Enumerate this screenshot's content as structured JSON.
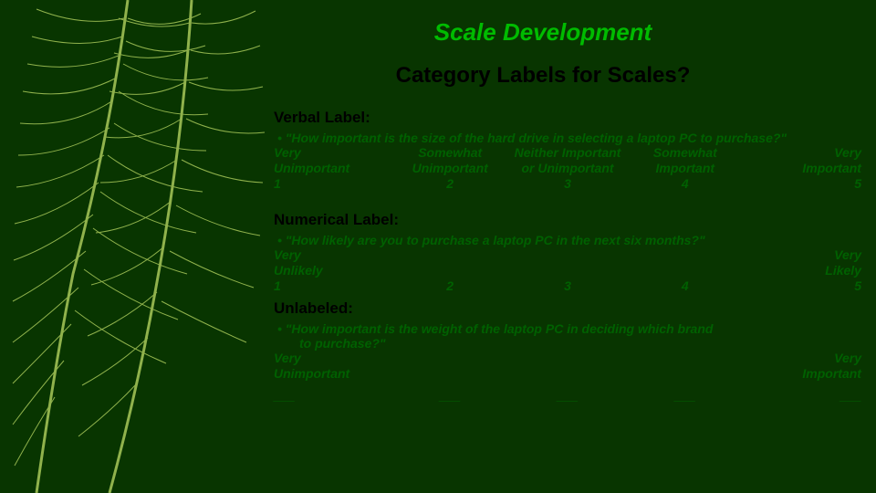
{
  "header": {
    "title": "Scale Development",
    "subtitle": "Category Labels for Scales?"
  },
  "sections": {
    "verbal": {
      "label": "Verbal Label:",
      "question": "\"How important is the size of the hard drive in selecting a laptop PC to purchase?\"",
      "cols": [
        {
          "l1": "Very",
          "l2": "Unimportant",
          "num": "1"
        },
        {
          "l1": "Somewhat",
          "l2": "Unimportant",
          "num": "2"
        },
        {
          "l1": "Neither Important",
          "l2": "or Unimportant",
          "num": "3"
        },
        {
          "l1": "Somewhat",
          "l2": "Important",
          "num": "4"
        },
        {
          "l1": "Very",
          "l2": "Important",
          "num": "5"
        }
      ]
    },
    "numerical": {
      "label": "Numerical Label:",
      "question": "\"How likely are you to purchase a laptop PC in the next six months?\"",
      "left": {
        "l1": "Very",
        "l2": "Unlikely",
        "num": "1"
      },
      "mid": [
        "2",
        "3",
        "4"
      ],
      "right": {
        "l1": "Very",
        "l2": "Likely",
        "num": "5"
      }
    },
    "unlabeled": {
      "label": "Unlabeled:",
      "question_l1": "\"How important is the weight of the laptop PC in deciding which brand",
      "question_l2": "to purchase?\"",
      "left": {
        "l1": "Very",
        "l2": "Unimportant"
      },
      "right": {
        "l1": "Very",
        "l2": "Important"
      },
      "blanks": [
        "___",
        "___",
        "___",
        "___",
        "___"
      ]
    }
  },
  "chart_data": {
    "type": "table",
    "title": "Category Labels for Scales?",
    "scales": [
      {
        "name": "Verbal Label",
        "question": "How important is the size of the hard drive in selecting a laptop PC to purchase?",
        "categories": [
          "Very Unimportant",
          "Somewhat Unimportant",
          "Neither Important or Unimportant",
          "Somewhat Important",
          "Very Important"
        ],
        "values": [
          1,
          2,
          3,
          4,
          5
        ]
      },
      {
        "name": "Numerical Label",
        "question": "How likely are you to purchase a laptop PC in the next six months?",
        "categories": [
          "Very Unlikely",
          "",
          "",
          "",
          "Very Likely"
        ],
        "values": [
          1,
          2,
          3,
          4,
          5
        ]
      },
      {
        "name": "Unlabeled",
        "question": "How important is the weight of the laptop PC in deciding which brand to purchase?",
        "categories": [
          "Very Unimportant",
          "",
          "",
          "",
          "Very Important"
        ],
        "values": [
          "___",
          "___",
          "___",
          "___",
          "___"
        ]
      }
    ]
  }
}
